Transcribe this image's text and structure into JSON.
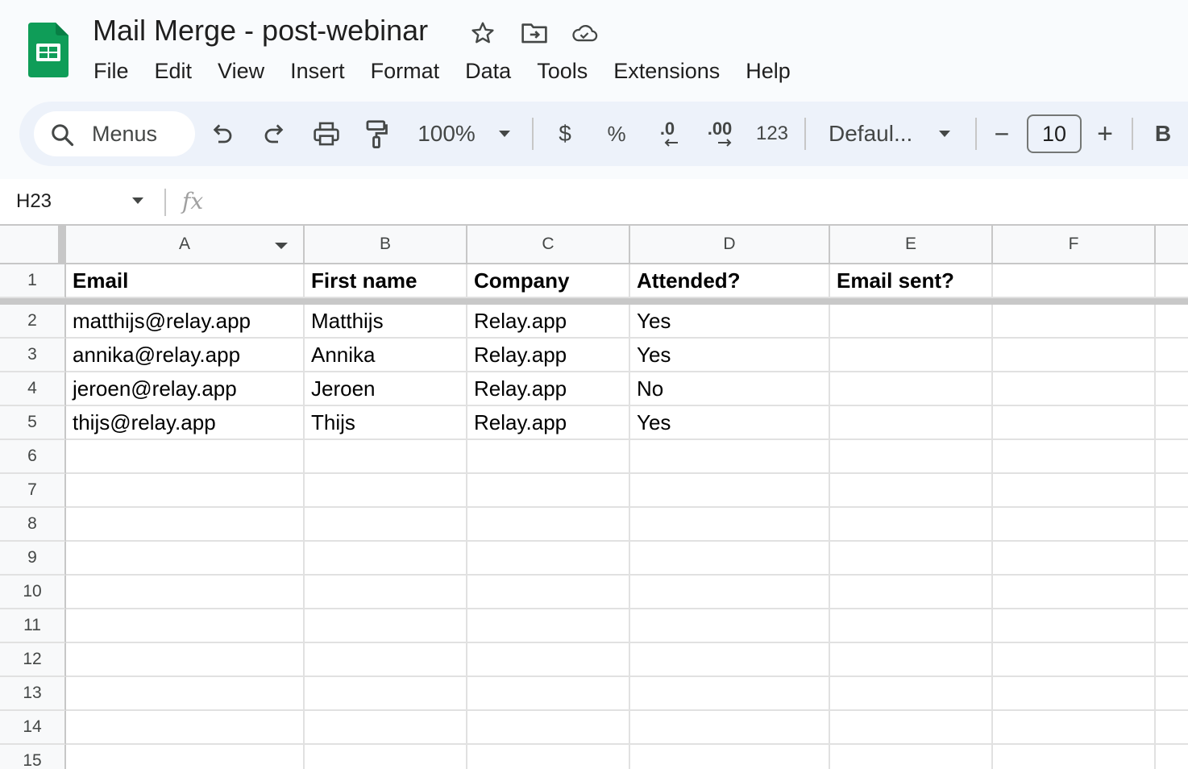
{
  "title": "Mail Merge - post-webinar",
  "menu": [
    "File",
    "Edit",
    "View",
    "Insert",
    "Format",
    "Data",
    "Tools",
    "Extensions",
    "Help"
  ],
  "toolbar": {
    "search_label": "Menus",
    "zoom": "100%",
    "currency": "$",
    "percent": "%",
    "decrease_decimal": ".0",
    "increase_decimal": ".00",
    "number_format": "123",
    "font": "Defaul...",
    "font_size": "10",
    "bold": "B",
    "minus": "−",
    "plus": "+"
  },
  "formula_bar": {
    "cell_ref": "H23",
    "fx": "fx",
    "value": ""
  },
  "columns": [
    "A",
    "B",
    "C",
    "D",
    "E",
    "F"
  ],
  "rows": [
    [
      "Email",
      "First name",
      "Company",
      "Attended?",
      "Email sent?",
      ""
    ],
    [
      "matthijs@relay.app",
      "Matthijs",
      "Relay.app",
      "Yes",
      "",
      ""
    ],
    [
      "annika@relay.app",
      "Annika",
      "Relay.app",
      "Yes",
      "",
      ""
    ],
    [
      "jeroen@relay.app",
      "Jeroen",
      "Relay.app",
      "No",
      "",
      ""
    ],
    [
      "thijs@relay.app",
      "Thijs",
      "Relay.app",
      "Yes",
      "",
      ""
    ],
    [
      "",
      "",
      "",
      "",
      "",
      ""
    ],
    [
      "",
      "",
      "",
      "",
      "",
      ""
    ],
    [
      "",
      "",
      "",
      "",
      "",
      ""
    ],
    [
      "",
      "",
      "",
      "",
      "",
      ""
    ],
    [
      "",
      "",
      "",
      "",
      "",
      ""
    ],
    [
      "",
      "",
      "",
      "",
      "",
      ""
    ],
    [
      "",
      "",
      "",
      "",
      "",
      ""
    ],
    [
      "",
      "",
      "",
      "",
      "",
      ""
    ],
    [
      "",
      "",
      "",
      "",
      "",
      ""
    ],
    [
      "",
      "",
      "",
      "",
      "",
      ""
    ]
  ],
  "row_numbers": [
    "1",
    "2",
    "3",
    "4",
    "5",
    "6",
    "7",
    "8",
    "9",
    "10",
    "11",
    "12",
    "13",
    "14",
    "15"
  ],
  "colors": {
    "sheets_green": "#0f9d58",
    "toolbar_bg": "#edf2fa",
    "grid_line": "#e1e1e1",
    "header_bg": "#f8f9fa"
  }
}
